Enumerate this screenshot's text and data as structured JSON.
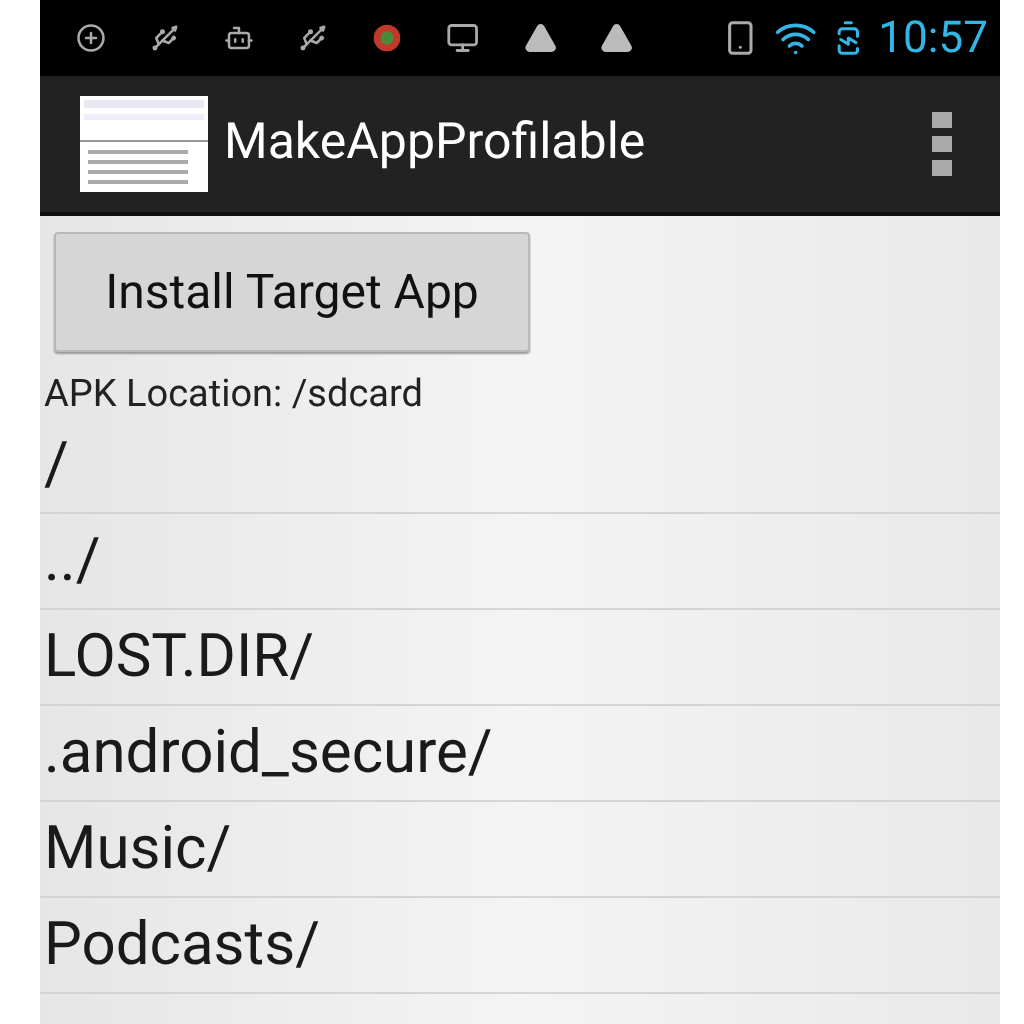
{
  "status_bar": {
    "time": "10:57"
  },
  "app_bar": {
    "title": "MakeAppProfilable"
  },
  "install_button": {
    "label": "Install Target App"
  },
  "apk_location": "APK Location: /sdcard",
  "files": [
    {
      "name": "/"
    },
    {
      "name": "../"
    },
    {
      "name": "LOST.DIR/"
    },
    {
      "name": ".android_secure/"
    },
    {
      "name": "Music/"
    },
    {
      "name": "Podcasts/"
    }
  ]
}
